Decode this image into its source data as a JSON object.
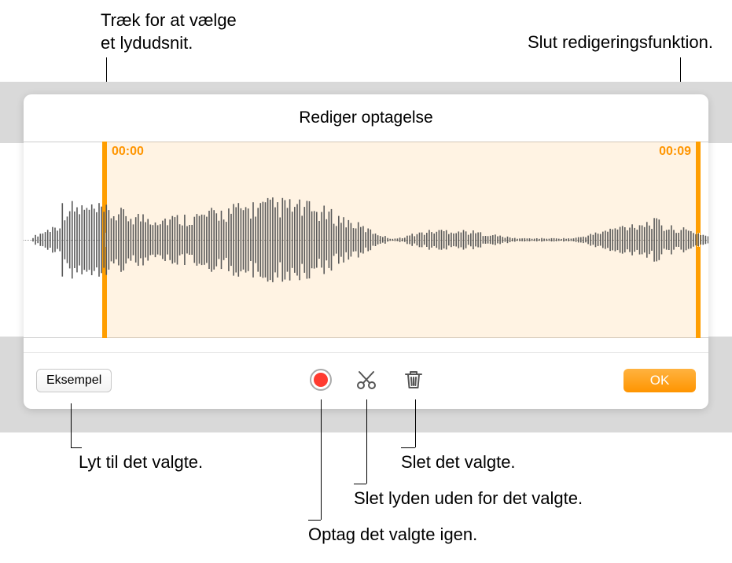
{
  "callouts": {
    "drag_select": "Træk for at vælge\net lydudsnit.",
    "end_edit": "Slut redigeringsfunktion.",
    "listen_selection": "Lyt til det valgte.",
    "delete_selection": "Slet det valgte.",
    "delete_outside": "Slet lyden uden for det valgte.",
    "rerecord_selection": "Optag det valgte igen."
  },
  "panel": {
    "title": "Rediger optagelse",
    "selection": {
      "start_time": "00:00",
      "end_time": "00:09"
    },
    "toolbar": {
      "preview_label": "Eksempel",
      "ok_label": "OK"
    }
  },
  "colors": {
    "accent": "#ff9500"
  }
}
